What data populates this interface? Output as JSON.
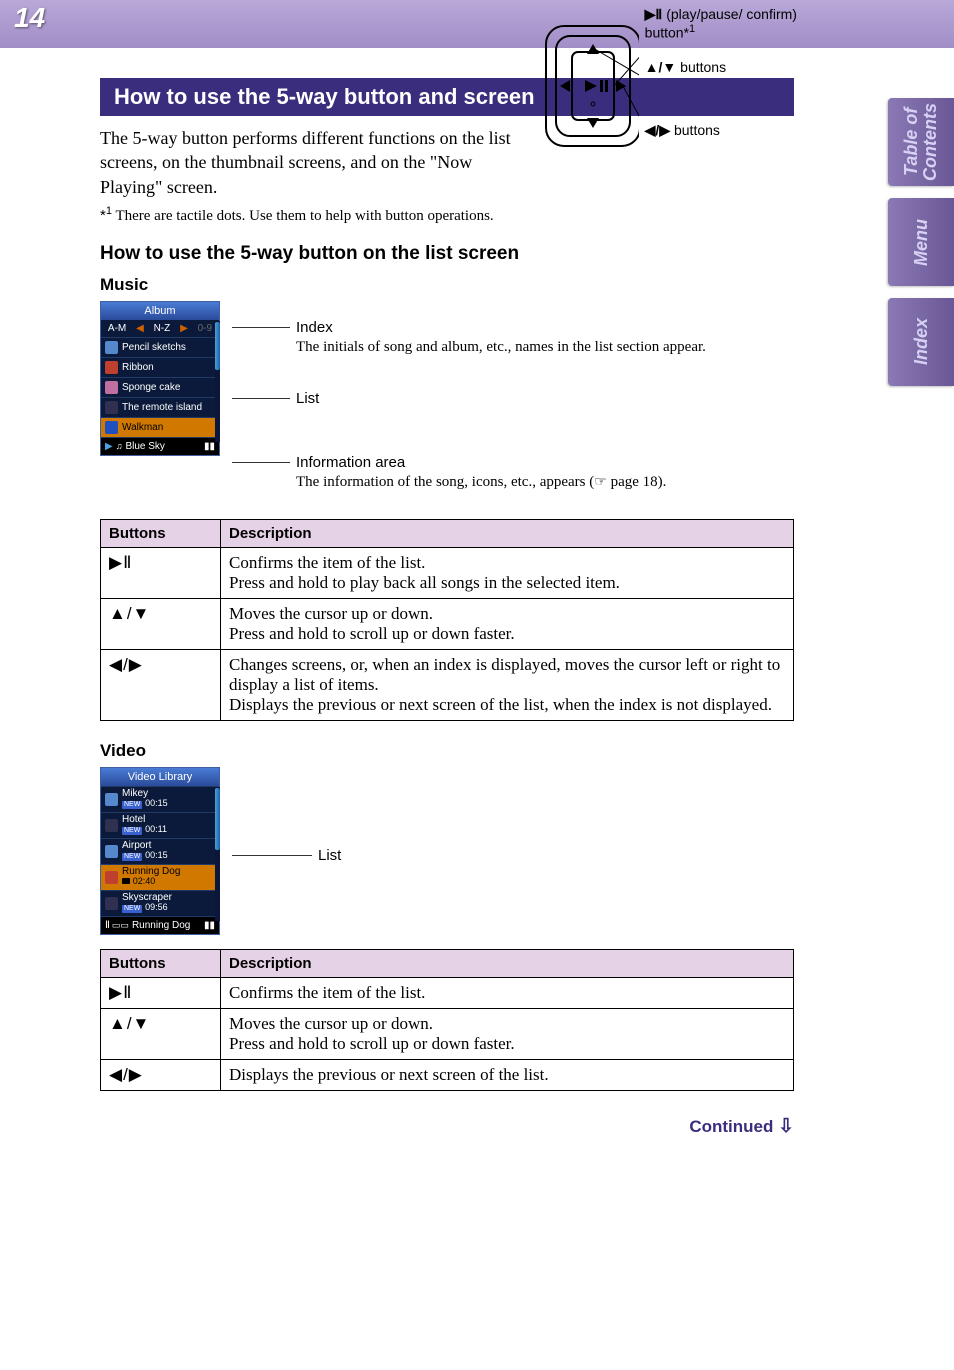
{
  "page_number": "14",
  "side_tabs": {
    "contents": "Table of\nContents",
    "menu": "Menu",
    "index": "Index"
  },
  "section_title": "How to use the 5-way button and screen",
  "intro": "The 5-way button performs different functions on the list screens, on the thumbnail screens, and on the \"Now Playing\" screen.",
  "footnote_marker": "*1",
  "footnote": "There are tactile dots. Use them to help with button operations.",
  "device_callouts": {
    "play": " (play/pause/ confirm) button*",
    "play_sup": "1",
    "updown": " buttons",
    "leftright": " buttons"
  },
  "subheading_list": "How to use the 5-way button on the list screen",
  "music_label": "Music",
  "music_screen": {
    "header": "Album",
    "index": {
      "left": "A-M",
      "mid": "N-Z",
      "right": "0-9"
    },
    "items": [
      "Pencil sketchs",
      "Ribbon",
      "Sponge cake",
      "The remote island",
      "Walkman"
    ],
    "footer_track": "Blue Sky"
  },
  "music_annotations": {
    "index_label": "Index",
    "index_desc": "The initials of song and album, etc., names in the list section appear.",
    "list_label": "List",
    "info_label": "Information area",
    "info_desc_pre": "The information of the song, icons, etc., appears (",
    "info_desc_post": " page 18)."
  },
  "table_headers": {
    "buttons": "Buttons",
    "description": "Description"
  },
  "music_table": {
    "play": "Confirms the item of the list.\nPress and hold to play back all songs in the selected item.",
    "updown": "Moves the cursor up or down.\nPress and hold to scroll up or down faster.",
    "leftright": "Changes screens, or, when an index is displayed, moves the cursor left or right to display a list of items.\nDisplays the previous or next screen of the list, when the index is not displayed."
  },
  "video_label": "Video",
  "video_screen": {
    "header": "Video Library",
    "items": [
      {
        "title": "Mikey",
        "dur": "00:15",
        "new": true
      },
      {
        "title": "Hotel",
        "dur": "00:11",
        "new": true
      },
      {
        "title": "Airport",
        "dur": "00:15",
        "new": true
      },
      {
        "title": "Running Dog",
        "dur": "02:40",
        "new": false,
        "sel": true
      },
      {
        "title": "Skyscraper",
        "dur": "09:56",
        "new": true
      }
    ],
    "footer": "Running Dog"
  },
  "video_annotation_list": "List",
  "video_table": {
    "play": "Confirms the item of the list.",
    "updown": "Moves the cursor up or down.\nPress and hold to scroll up or down faster.",
    "leftright": "Displays the previous or next screen of the list."
  },
  "continued": "Continued "
}
